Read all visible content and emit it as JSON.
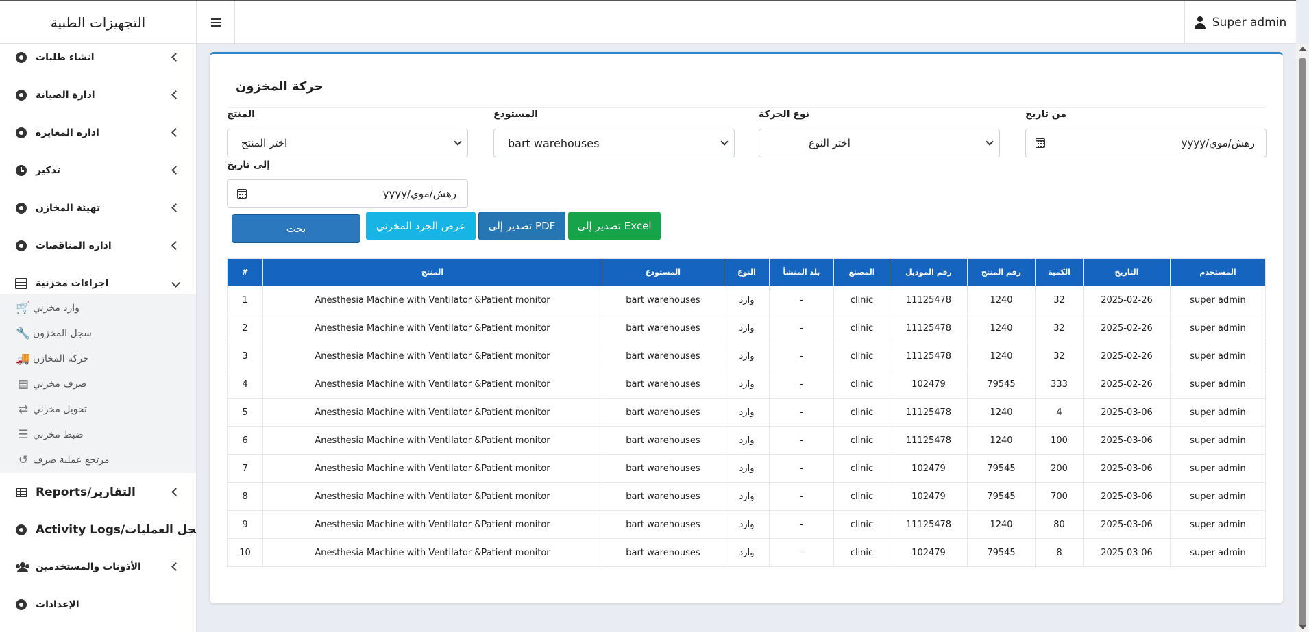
{
  "header": {
    "brand": "التجهيزات الطبية",
    "user": "Super admin"
  },
  "sidebar": {
    "items": [
      {
        "label": "انشاء طلبات",
        "icon": "gear-icon"
      },
      {
        "label": "ادارة الصيانة",
        "icon": "gear-icon"
      },
      {
        "label": "ادارة المعايرة",
        "icon": "gear-icon"
      },
      {
        "label": "تذكير",
        "icon": "clock-icon"
      },
      {
        "label": "تهيئة المخازن",
        "icon": "gear-icon"
      },
      {
        "label": "ادارة المناقصات",
        "icon": "gear-icon"
      },
      {
        "label": "اجراءات مخزنية",
        "icon": "warehouse-icon"
      }
    ],
    "sub_items": [
      {
        "label": "وارد مخزني",
        "icon": "cart-icon"
      },
      {
        "label": "سجل المخزون",
        "icon": "wrench-icon"
      },
      {
        "label": "حركة المخازن",
        "icon": "truck-icon"
      },
      {
        "label": "صرف مخزني",
        "icon": "dispense-icon"
      },
      {
        "label": "تحويل مخزني",
        "icon": "transfer-icon"
      },
      {
        "label": "ضبط مخزني",
        "icon": "sliders-icon"
      },
      {
        "label": "مرتجع عملية صرف",
        "icon": "undo-icon"
      }
    ],
    "bottom_items": [
      {
        "label": "Reports/التقارير",
        "icon": "table-icon"
      },
      {
        "label": "Activity Logs/سجل العمليات",
        "icon": "gear-icon"
      },
      {
        "label": "الأذونات والمستخدمين",
        "icon": "users-icon"
      },
      {
        "label": "الإعدادات",
        "icon": "gear-icon"
      }
    ]
  },
  "page": {
    "title": "حركة المخزون",
    "filters": {
      "from_date_label": "من تاريخ",
      "from_date_value": "yyyy/رهش/موي",
      "move_type_label": "نوع الحركة",
      "move_type_value": "اختر النوع",
      "warehouse_label": "المستودع",
      "warehouse_value": "bart warehouses",
      "product_label": "المنتج",
      "product_value": "اختر المنتج",
      "to_date_label": "إلى تاريخ",
      "to_date_value": "yyyy/رهش/موي"
    },
    "buttons": {
      "excel": "تصدير إلى Excel",
      "pdf": "تصدير إلى PDF",
      "inventory": "عرض الجرد المخزني",
      "search": "بحث"
    }
  },
  "table": {
    "headers": [
      "المستخدم",
      "التاريخ",
      "الكمية",
      "رقم المنتج",
      "رقم الموديل",
      "المصنع",
      "بلد المنشأ",
      "النوع",
      "المستودع",
      "المنتج",
      "#"
    ],
    "rows": [
      [
        "super admin",
        "2025-02-26",
        "32",
        "1240",
        "11125478",
        "clinic",
        "-",
        "وارد",
        "bart warehouses",
        "Anesthesia Machine with Ventilator &Patient monitor",
        "1"
      ],
      [
        "super admin",
        "2025-02-26",
        "32",
        "1240",
        "11125478",
        "clinic",
        "-",
        "وارد",
        "bart warehouses",
        "Anesthesia Machine with Ventilator &Patient monitor",
        "2"
      ],
      [
        "super admin",
        "2025-02-26",
        "32",
        "1240",
        "11125478",
        "clinic",
        "-",
        "وارد",
        "bart warehouses",
        "Anesthesia Machine with Ventilator &Patient monitor",
        "3"
      ],
      [
        "super admin",
        "2025-02-26",
        "333",
        "79545",
        "102479",
        "clinic",
        "-",
        "وارد",
        "bart warehouses",
        "Anesthesia Machine with Ventilator &Patient monitor",
        "4"
      ],
      [
        "super admin",
        "2025-03-06",
        "4",
        "1240",
        "11125478",
        "clinic",
        "-",
        "وارد",
        "bart warehouses",
        "Anesthesia Machine with Ventilator &Patient monitor",
        "5"
      ],
      [
        "super admin",
        "2025-03-06",
        "100",
        "1240",
        "11125478",
        "clinic",
        "-",
        "وارد",
        "bart warehouses",
        "Anesthesia Machine with Ventilator &Patient monitor",
        "6"
      ],
      [
        "super admin",
        "2025-03-06",
        "200",
        "79545",
        "102479",
        "clinic",
        "-",
        "وارد",
        "bart warehouses",
        "Anesthesia Machine with Ventilator &Patient monitor",
        "7"
      ],
      [
        "super admin",
        "2025-03-06",
        "700",
        "79545",
        "102479",
        "clinic",
        "-",
        "وارد",
        "bart warehouses",
        "Anesthesia Machine with Ventilator &Patient monitor",
        "8"
      ],
      [
        "super admin",
        "2025-03-06",
        "80",
        "1240",
        "11125478",
        "clinic",
        "-",
        "وارد",
        "bart warehouses",
        "Anesthesia Machine with Ventilator &Patient monitor",
        "9"
      ],
      [
        "super admin",
        "2025-03-06",
        "8",
        "79545",
        "102479",
        "clinic",
        "-",
        "وارد",
        "bart warehouses",
        "Anesthesia Machine with Ventilator &Patient monitor",
        "10"
      ]
    ]
  },
  "colors": {
    "table_header": "#1565c0",
    "accent": "#2f86c8",
    "excel_button": "#17a34a",
    "inventory_button": "#16b5e5"
  }
}
